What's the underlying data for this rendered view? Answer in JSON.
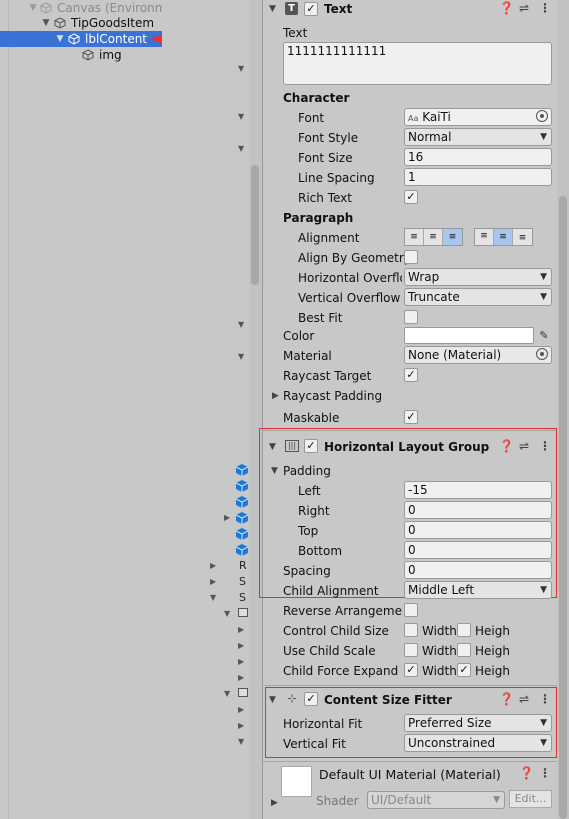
{
  "hierarchy": {
    "rows": [
      {
        "label": "Canvas (Environm"
      },
      {
        "label": "TipGoodsItem"
      },
      {
        "label": "lblContent"
      },
      {
        "label": "img"
      }
    ],
    "mid_letters": [
      "R",
      "S",
      "S"
    ]
  },
  "text_component": {
    "title": "Text",
    "text_label": "Text",
    "text_value": "1111111111111",
    "character_header": "Character",
    "font_label": "Font",
    "font_value": "KaiTi",
    "font_style_label": "Font Style",
    "font_style_value": "Normal",
    "font_size_label": "Font Size",
    "font_size_value": "16",
    "line_spacing_label": "Line Spacing",
    "line_spacing_value": "1",
    "rich_text_label": "Rich Text",
    "paragraph_header": "Paragraph",
    "alignment_label": "Alignment",
    "align_by_geometry_label": "Align By Geometry",
    "horizontal_overflow_label": "Horizontal Overflo",
    "horizontal_overflow_value": "Wrap",
    "vertical_overflow_label": "Vertical Overflow",
    "vertical_overflow_value": "Truncate",
    "best_fit_label": "Best Fit",
    "color_label": "Color",
    "material_label": "Material",
    "material_value": "None (Material)",
    "raycast_target_label": "Raycast Target",
    "raycast_padding_label": "Raycast Padding",
    "maskable_label": "Maskable"
  },
  "horizontal_layout_group": {
    "title": "Horizontal Layout Group",
    "padding_label": "Padding",
    "left_label": "Left",
    "left_value": "-15",
    "right_label": "Right",
    "right_value": "0",
    "top_label": "Top",
    "top_value": "0",
    "bottom_label": "Bottom",
    "bottom_value": "0",
    "spacing_label": "Spacing",
    "spacing_value": "0",
    "child_alignment_label": "Child Alignment",
    "child_alignment_value": "Middle Left",
    "reverse_arrangement_label": "Reverse Arrangemen",
    "control_child_size_label": "Control Child Size",
    "use_child_scale_label": "Use Child Scale",
    "child_force_expand_label": "Child Force Expand",
    "width_label": "Width",
    "height_label": "Heigh"
  },
  "content_size_fitter": {
    "title": "Content Size Fitter",
    "horizontal_fit_label": "Horizontal Fit",
    "horizontal_fit_value": "Preferred Size",
    "vertical_fit_label": "Vertical Fit",
    "vertical_fit_value": "Unconstrained"
  },
  "material_footer": {
    "title": "Default UI Material (Material)",
    "shader_label": "Shader",
    "shader_value": "UI/Default",
    "edit_label": "Edit..."
  },
  "colors": {
    "selection": "#3a72d6",
    "highlight_box": "#e03030",
    "arrow": "#e83030",
    "cube_blue": "#1f78d8",
    "align_active": "#a9c6ef"
  }
}
